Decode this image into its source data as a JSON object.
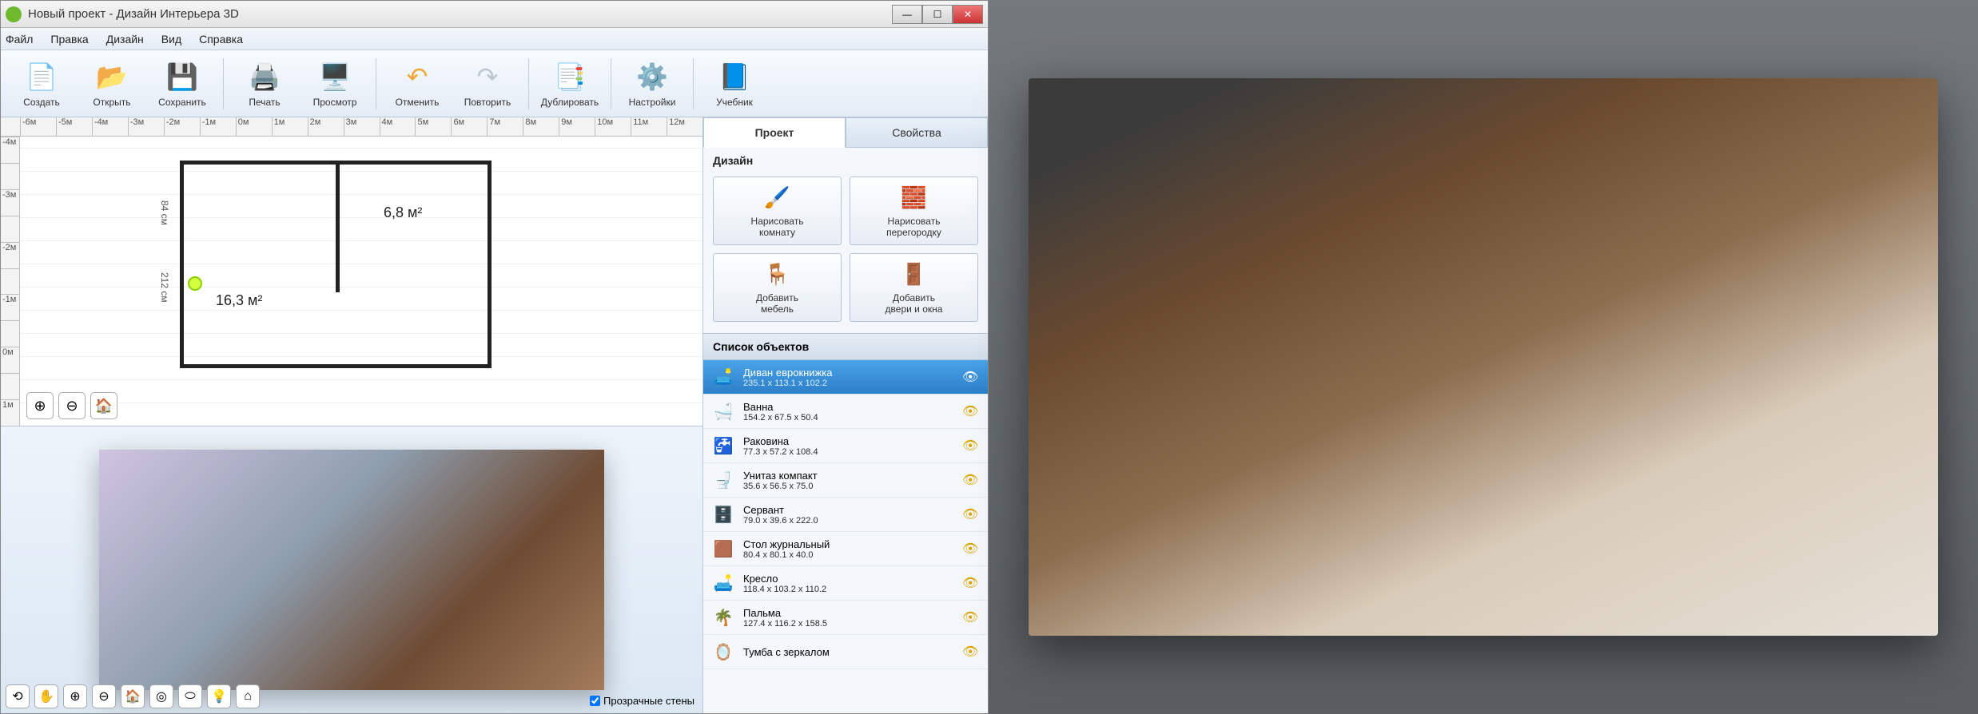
{
  "titlebar": {
    "title": "Новый проект - Дизайн Интерьера 3D"
  },
  "menu": [
    "Файл",
    "Правка",
    "Дизайн",
    "Вид",
    "Справка"
  ],
  "toolbar": [
    {
      "label": "Создать",
      "icon": "📄",
      "color": "#f0f0f0"
    },
    {
      "label": "Открыть",
      "icon": "📂",
      "color": "#f4c560"
    },
    {
      "label": "Сохранить",
      "icon": "💾",
      "color": "#8fc2f0"
    },
    {
      "label": "Печать",
      "icon": "🖨️",
      "color": "#bbb"
    },
    {
      "label": "Просмотр",
      "icon": "🖥️",
      "color": "#5a9be0"
    },
    {
      "label": "Отменить",
      "icon": "↶",
      "color": "#f0a83a"
    },
    {
      "label": "Повторить",
      "icon": "↷",
      "color": "#bcc6d0"
    },
    {
      "label": "Дублировать",
      "icon": "📑",
      "color": "#6fa8e2"
    },
    {
      "label": "Настройки",
      "icon": "⚙️",
      "color": "#6fa8e2"
    },
    {
      "label": "Учебник",
      "icon": "📘",
      "color": "#4a8be0"
    }
  ],
  "toolbar_seps": [
    2,
    4,
    6,
    7,
    8
  ],
  "ruler_h": [
    "-6м",
    "-5м",
    "-4м",
    "-3м",
    "-2м",
    "-1м",
    "0м",
    "1м",
    "2м",
    "3м",
    "4м",
    "5м",
    "6м",
    "7м",
    "8м",
    "9м",
    "10м",
    "11м",
    "12м"
  ],
  "ruler_v": [
    "-4м",
    "",
    "-3м",
    "",
    "-2м",
    "",
    "-1м",
    "",
    "0м",
    "",
    "1м"
  ],
  "plan": {
    "room1_area": "16,3 м²",
    "room2_area": "6,8 м²",
    "dim_w": "84 см",
    "dim_h": "212 см"
  },
  "zoom_icons": [
    "⊕",
    "⊖",
    "🏠"
  ],
  "bottom_icons": [
    "⟲",
    "✋",
    "⊕",
    "⊖",
    "🏠",
    "◎",
    "⬭",
    "💡",
    "⌂"
  ],
  "walls_checkbox": "Прозрачные стены",
  "tabs": [
    "Проект",
    "Свойства"
  ],
  "design_title": "Дизайн",
  "design_buttons": [
    {
      "label": "Нарисовать комнату",
      "icon": "🖌️"
    },
    {
      "label": "Нарисовать перегородку",
      "icon": "🧱"
    },
    {
      "label": "Добавить мебель",
      "icon": "🪑"
    },
    {
      "label": "Добавить двери и окна",
      "icon": "🚪"
    }
  ],
  "objects_title": "Список объектов",
  "objects": [
    {
      "name": "Диван еврокнижка",
      "dim": "235.1 x 113.1 x 102.2",
      "icon": "🛋️",
      "selected": true
    },
    {
      "name": "Ванна",
      "dim": "154.2 x 67.5 x 50.4",
      "icon": "🛁"
    },
    {
      "name": "Раковина",
      "dim": "77.3 x 57.2 x 108.4",
      "icon": "🚰"
    },
    {
      "name": "Унитаз компакт",
      "dim": "35.6 x 56.5 x 75.0",
      "icon": "🚽"
    },
    {
      "name": "Сервант",
      "dim": "79.0 x 39.6 x 222.0",
      "icon": "🗄️"
    },
    {
      "name": "Стол журнальный",
      "dim": "80.4 x 80.1 x 40.0",
      "icon": "🟫"
    },
    {
      "name": "Кресло",
      "dim": "118.4 x 103.2 x 110.2",
      "icon": "🛋️"
    },
    {
      "name": "Пальма",
      "dim": "127.4 x 116.2 x 158.5",
      "icon": "🌴"
    },
    {
      "name": "Тумба с зеркалом",
      "dim": "",
      "icon": "🪞"
    }
  ]
}
